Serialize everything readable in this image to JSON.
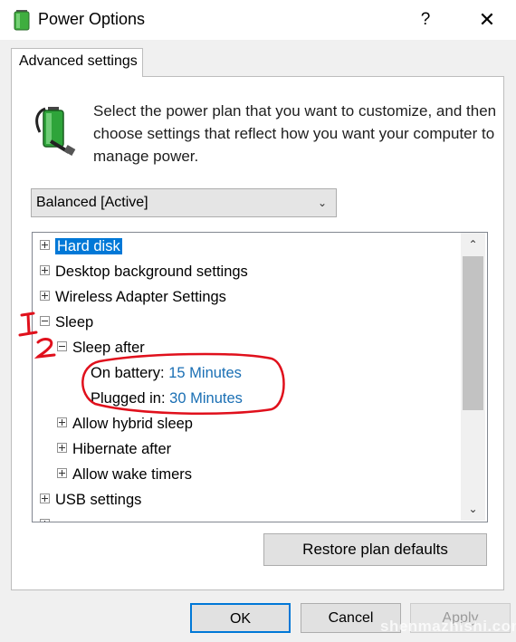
{
  "window": {
    "title": "Power Options",
    "help_label": "?",
    "close_label": "✕"
  },
  "tab": {
    "label": "Advanced settings"
  },
  "description": "Select the power plan that you want to customize, and then choose settings that reflect how you want your computer to manage power.",
  "plan_select": {
    "value": "Balanced [Active]"
  },
  "tree": {
    "hard_disk": "Hard disk",
    "desktop_background": "Desktop background settings",
    "wireless_adapter": "Wireless Adapter Settings",
    "sleep": "Sleep",
    "sleep_after": "Sleep after",
    "on_battery_label": "On battery:",
    "on_battery_value": "15 Minutes",
    "plugged_in_label": "Plugged in:",
    "plugged_in_value": "30 Minutes",
    "allow_hybrid_sleep": "Allow hybrid sleep",
    "hibernate_after": "Hibernate after",
    "allow_wake_timers": "Allow wake timers",
    "usb_settings": "USB settings"
  },
  "buttons": {
    "restore": "Restore plan defaults",
    "ok": "OK",
    "cancel": "Cancel",
    "apply": "Apply"
  },
  "watermark": "shenmazhishi.com",
  "colors": {
    "selection": "#0078d7",
    "value_link": "#1a6fb4",
    "annotation_red": "#e0101c"
  }
}
